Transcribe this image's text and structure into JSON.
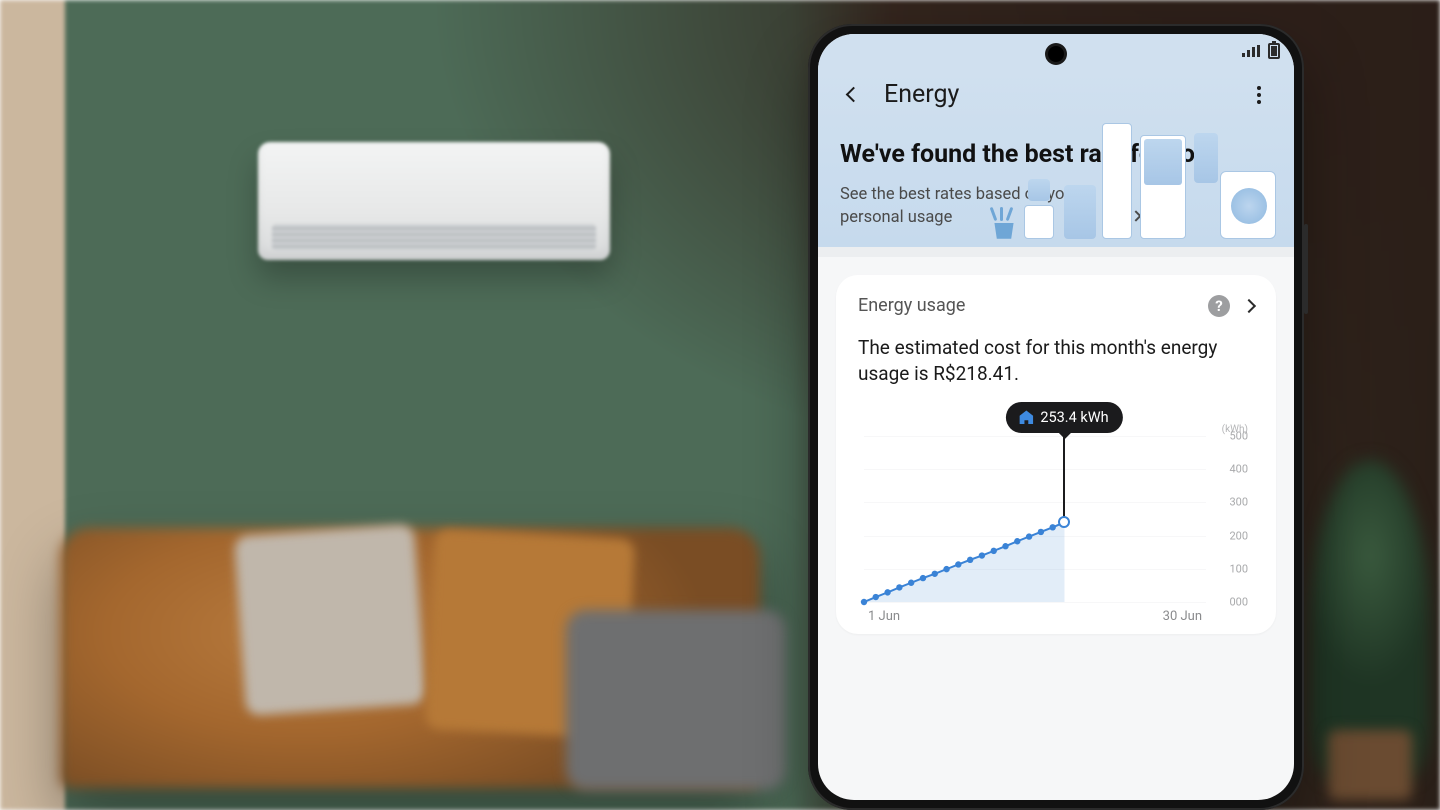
{
  "header": {
    "title": "Energy"
  },
  "hero": {
    "headline": "We've found the best rate for you",
    "subtext": "See the best rates based on your personal usage"
  },
  "usage_card": {
    "title": "Energy usage",
    "body_prefix": "The estimated cost for this month's energy usage is ",
    "cost": "R$218.41",
    "body_suffix": "."
  },
  "chart_data": {
    "type": "line",
    "title": "",
    "xlabel_left": "1 Jun",
    "xlabel_right": "30 Jun",
    "ylabel_unit": "(kWh)",
    "ylim": [
      0,
      500
    ],
    "yticks": [
      0,
      100,
      200,
      300,
      400,
      500
    ],
    "ytick_labels": [
      "000",
      "100",
      "200",
      "300",
      "400",
      "500"
    ],
    "x": [
      1,
      2,
      3,
      4,
      5,
      6,
      7,
      8,
      9,
      10,
      11,
      12,
      13,
      14,
      15,
      16,
      17,
      18
    ],
    "values": [
      0,
      15,
      29,
      44,
      58,
      72,
      85,
      99,
      113,
      127,
      140,
      154,
      168,
      183,
      197,
      211,
      225,
      240
    ],
    "tooltip": {
      "x": 18,
      "label": "253.4 kWh"
    },
    "x_domain": [
      1,
      30
    ]
  }
}
